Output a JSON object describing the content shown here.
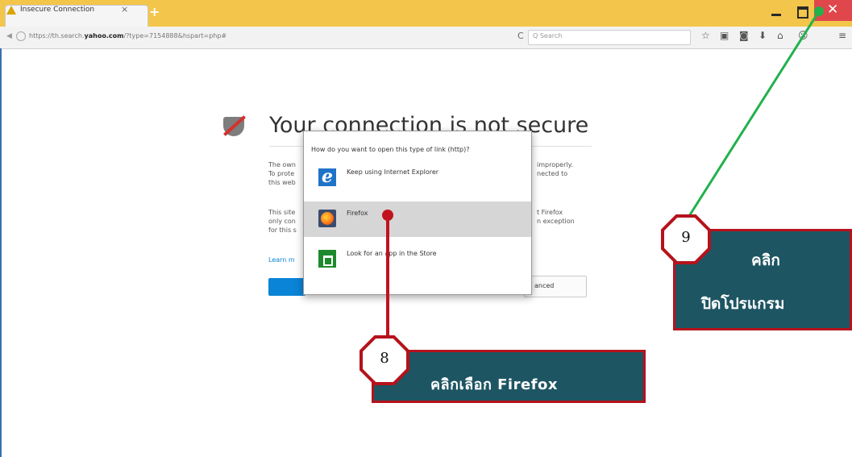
{
  "browser": {
    "tab_title": "Insecure Connection",
    "tab_close": "×",
    "new_tab": "+",
    "back": "◀",
    "url_prefix": "https://th.search.",
    "url_domain": "yahoo.com",
    "url_suffix": "/?type=7154888&hspart=php#",
    "reload": "C",
    "search_placeholder": "Q Search",
    "toolbar_icons": [
      "star-icon",
      "reading-list-icon",
      "pocket-icon",
      "download-icon",
      "home-icon",
      "emoji-icon",
      "menu-icon"
    ],
    "toolbar_glyphs": [
      "☆",
      "▣",
      "◙",
      "⬇",
      "⌂",
      "☺",
      "≡"
    ],
    "close_glyph": "✕"
  },
  "error_page": {
    "title": "Your connection is not secure",
    "para1_left": [
      "The own",
      "To prote",
      "this web"
    ],
    "para1_right": [
      "improperly.",
      "nected to"
    ],
    "para2_left": [
      "This site",
      "only con",
      "for this s"
    ],
    "para2_right": [
      "t Firefox",
      "n exception"
    ],
    "learn_more": "Learn m",
    "advanced_button": "anced"
  },
  "dialog": {
    "question": "How do you want to open this type of link (http)?",
    "options": [
      {
        "label": "Keep using Internet Explorer",
        "icon": "internet-explorer-icon"
      },
      {
        "label": "Firefox",
        "icon": "firefox-icon"
      },
      {
        "label": "Look for an app in the Store",
        "icon": "store-icon"
      }
    ],
    "selected": "Firefox"
  },
  "annotations": {
    "step8": {
      "number": "8",
      "text": "คลิกเลือก  Firefox",
      "color": "#c1121f"
    },
    "step9": {
      "number": "9",
      "line1": "คลิก",
      "line2": "ปิดโปรแกรม",
      "color": "#22b14c"
    },
    "box_color": "#1e5563"
  }
}
